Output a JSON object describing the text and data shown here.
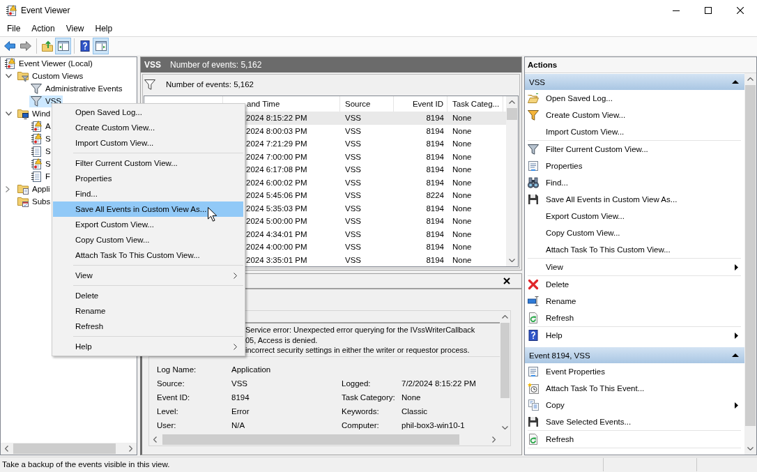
{
  "window": {
    "title": "Event Viewer"
  },
  "menu_bar": [
    "File",
    "Action",
    "View",
    "Help"
  ],
  "toolbar": [
    {
      "kind": "back",
      "pressed": false,
      "disabled": false
    },
    {
      "kind": "forward",
      "pressed": false,
      "disabled": true
    },
    {
      "kind": "separator"
    },
    {
      "kind": "up",
      "pressed": false,
      "disabled": false
    },
    {
      "kind": "tree",
      "pressed": true,
      "disabled": false
    },
    {
      "kind": "separator"
    },
    {
      "kind": "help",
      "pressed": false,
      "disabled": false
    },
    {
      "kind": "actions",
      "pressed": true,
      "disabled": false
    }
  ],
  "tree": [
    {
      "label": "Event Viewer (Local)",
      "kind": "viewer",
      "selected": false,
      "children": [
        {
          "label": "Custom Views",
          "kind": "viewfolder",
          "expanded": true,
          "selected": false,
          "children": [
            {
              "label": "Administrative Events",
              "kind": "funnel",
              "selected": false
            },
            {
              "label": "VSS",
              "kind": "funnel",
              "selected": true
            }
          ]
        },
        {
          "label": "Wind",
          "kind": "logfolder",
          "expanded": true,
          "selected": false,
          "children": [
            {
              "label": "A",
              "kind": "warnlog",
              "selected": false
            },
            {
              "label": "S",
              "kind": "warnlog",
              "selected": false
            },
            {
              "label": "S",
              "kind": "log",
              "selected": false
            },
            {
              "label": "S",
              "kind": "warnlog",
              "selected": false
            },
            {
              "label": "F",
              "kind": "log",
              "selected": false
            }
          ]
        },
        {
          "label": "Appli",
          "kind": "appfolder",
          "expanded": false,
          "selected": false
        },
        {
          "label": "Subs",
          "kind": "subfolder",
          "selected": false
        }
      ]
    }
  ],
  "view_header": {
    "title": "VSS",
    "count": "Number of events: 5,162"
  },
  "events": {
    "count": "Number of events: 5,162",
    "columns": [
      {
        "label": "and Time",
        "kind": "text"
      },
      {
        "label": "Source",
        "kind": "text"
      },
      {
        "label": "Event ID",
        "kind": "number"
      },
      {
        "label": "Task Categ...",
        "kind": "text"
      }
    ],
    "rows": [
      {
        "cells": [
          "2024 8:15:22 PM",
          "VSS",
          "8194",
          "None"
        ],
        "selected": true
      },
      {
        "cells": [
          "2024 8:00:03 PM",
          "VSS",
          "8194",
          "None"
        ],
        "selected": false
      },
      {
        "cells": [
          "2024 7:21:29 PM",
          "VSS",
          "8194",
          "None"
        ],
        "selected": false
      },
      {
        "cells": [
          "2024 7:00:00 PM",
          "VSS",
          "8194",
          "None"
        ],
        "selected": false
      },
      {
        "cells": [
          "2024 6:17:08 PM",
          "VSS",
          "8194",
          "None"
        ],
        "selected": false
      },
      {
        "cells": [
          "2024 6:00:02 PM",
          "VSS",
          "8194",
          "None"
        ],
        "selected": false
      },
      {
        "cells": [
          "2024 5:45:06 PM",
          "VSS",
          "8224",
          "None"
        ],
        "selected": false
      },
      {
        "cells": [
          "2024 5:35:03 PM",
          "VSS",
          "8194",
          "None"
        ],
        "selected": false
      },
      {
        "cells": [
          "2024 5:00:00 PM",
          "VSS",
          "8194",
          "None"
        ],
        "selected": false
      },
      {
        "cells": [
          "2024 4:34:01 PM",
          "VSS",
          "8194",
          "None"
        ],
        "selected": false
      },
      {
        "cells": [
          "2024 4:00:00 PM",
          "VSS",
          "8194",
          "None"
        ],
        "selected": false
      },
      {
        "cells": [
          "2024 3:35:01 PM",
          "VSS",
          "8194",
          "None"
        ],
        "selected": false
      }
    ]
  },
  "details": {
    "message_lines": [
      "Service error: Unexpected error querying for the IVssWriterCallback",
      "05, Access is denied.",
      "incorrect security settings in either the writer or requestor process."
    ],
    "fields": [
      [
        {
          "label": "Log Name:",
          "value": "Application"
        }
      ],
      [
        {
          "label": "Source:",
          "value": "VSS"
        },
        {
          "label": "Logged:",
          "value": "7/2/2024 8:15:22 PM"
        }
      ],
      [
        {
          "label": "Event ID:",
          "value": "8194"
        },
        {
          "label": "Task Category:",
          "value": "None"
        }
      ],
      [
        {
          "label": "Level:",
          "value": "Error"
        },
        {
          "label": "Keywords:",
          "value": "Classic"
        }
      ],
      [
        {
          "label": "User:",
          "value": "N/A"
        },
        {
          "label": "Computer:",
          "value": "phil-box3-win10-1"
        }
      ]
    ]
  },
  "actions": {
    "title": "Actions",
    "sections": [
      {
        "title": "VSS",
        "expanded": true,
        "items": [
          {
            "kind": "open",
            "label": "Open Saved Log...",
            "submenu": false
          },
          {
            "kind": "create",
            "label": "Create Custom View...",
            "submenu": false
          },
          {
            "kind": "plain",
            "label": "Import Custom View...",
            "submenu": false
          },
          {
            "kind": "separator"
          },
          {
            "kind": "filter",
            "label": "Filter Current Custom View...",
            "submenu": false
          },
          {
            "kind": "properties",
            "label": "Properties",
            "submenu": false
          },
          {
            "kind": "find",
            "label": "Find...",
            "submenu": false
          },
          {
            "kind": "save",
            "label": "Save All Events in Custom View As...",
            "submenu": false
          },
          {
            "kind": "plain",
            "label": "Export Custom View...",
            "submenu": false
          },
          {
            "kind": "plain",
            "label": "Copy Custom View...",
            "submenu": false
          },
          {
            "kind": "plain",
            "label": "Attach Task To This Custom View...",
            "submenu": false
          },
          {
            "kind": "separator"
          },
          {
            "kind": "plain",
            "label": "View",
            "submenu": true
          },
          {
            "kind": "separator"
          },
          {
            "kind": "delete",
            "label": "Delete",
            "submenu": false
          },
          {
            "kind": "rename",
            "label": "Rename",
            "submenu": false
          },
          {
            "kind": "refresh",
            "label": "Refresh",
            "submenu": false
          },
          {
            "kind": "separator"
          },
          {
            "kind": "help",
            "label": "Help",
            "submenu": true
          }
        ]
      },
      {
        "title": "Event 8194, VSS",
        "expanded": true,
        "items": [
          {
            "kind": "properties",
            "label": "Event Properties",
            "submenu": false
          },
          {
            "kind": "attach",
            "label": "Attach Task To This Event...",
            "submenu": false
          },
          {
            "kind": "copy",
            "label": "Copy",
            "submenu": true
          },
          {
            "kind": "save",
            "label": "Save Selected Events...",
            "submenu": false
          },
          {
            "kind": "separator"
          },
          {
            "kind": "refresh",
            "label": "Refresh",
            "submenu": false
          },
          {
            "kind": "separator"
          }
        ]
      }
    ]
  },
  "context_menu": {
    "items": [
      {
        "kind": "item",
        "label": "Open Saved Log...",
        "selected": false,
        "submenu": false
      },
      {
        "kind": "item",
        "label": "Create Custom View...",
        "selected": false,
        "submenu": false
      },
      {
        "kind": "item",
        "label": "Import Custom View...",
        "selected": false,
        "submenu": false
      },
      {
        "kind": "separator"
      },
      {
        "kind": "item",
        "label": "Filter Current Custom View...",
        "selected": false,
        "submenu": false
      },
      {
        "kind": "item",
        "label": "Properties",
        "selected": false,
        "submenu": false
      },
      {
        "kind": "item",
        "label": "Find...",
        "selected": false,
        "submenu": false
      },
      {
        "kind": "item",
        "label": "Save All Events in Custom View As...",
        "selected": true,
        "submenu": false
      },
      {
        "kind": "item",
        "label": "Export Custom View...",
        "selected": false,
        "submenu": false
      },
      {
        "kind": "item",
        "label": "Copy Custom View...",
        "selected": false,
        "submenu": false
      },
      {
        "kind": "item",
        "label": "Attach Task To This Custom View...",
        "selected": false,
        "submenu": false
      },
      {
        "kind": "separator"
      },
      {
        "kind": "item",
        "label": "View",
        "selected": false,
        "submenu": true
      },
      {
        "kind": "separator"
      },
      {
        "kind": "item",
        "label": "Delete",
        "selected": false,
        "submenu": false
      },
      {
        "kind": "item",
        "label": "Rename",
        "selected": false,
        "submenu": false
      },
      {
        "kind": "item",
        "label": "Refresh",
        "selected": false,
        "submenu": false
      },
      {
        "kind": "separator"
      },
      {
        "kind": "item",
        "label": "Help",
        "selected": false,
        "submenu": true
      }
    ]
  },
  "status_bar": {
    "text": "Take a backup of the events visible in this view."
  }
}
